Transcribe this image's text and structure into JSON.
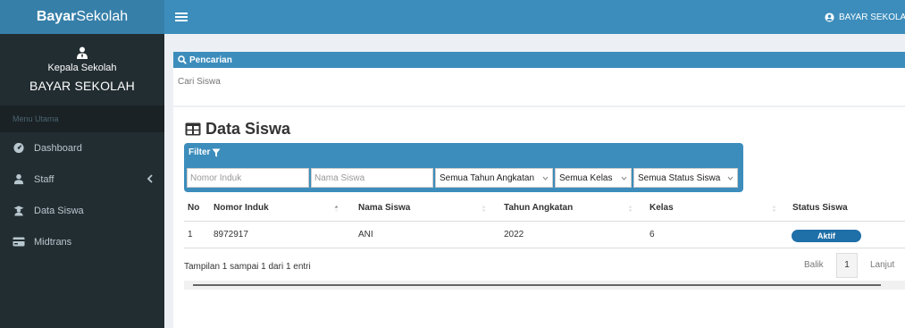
{
  "brand": {
    "bold": "Bayar",
    "rest": "Sekolah"
  },
  "user_panel": {
    "role": "Kepala Sekolah",
    "name": "BAYAR SEKOLAH"
  },
  "sidebar": {
    "header": "Menu Utama",
    "items": [
      {
        "label": "Dashboard",
        "icon": "dashboard-icon"
      },
      {
        "label": "Staff",
        "icon": "user-icon"
      },
      {
        "label": "Data Siswa",
        "icon": "student-icon"
      },
      {
        "label": "Midtrans",
        "icon": "credit-card-icon"
      }
    ]
  },
  "topbar": {
    "user": "BAYAR SEKOLAH"
  },
  "search": {
    "title": "Pencarian",
    "placeholder": "Cari Siswa"
  },
  "page": {
    "title": "Data Siswa"
  },
  "filter": {
    "label": "Filter",
    "nomor_placeholder": "Nomor Induk",
    "nama_placeholder": "Nama Siswa",
    "tahun_selected": "Semua Tahun Angkatan",
    "kelas_selected": "Semua Kelas",
    "status_selected": "Semua Status Siswa"
  },
  "table": {
    "headers": [
      "No",
      "Nomor Induk",
      "Nama Siswa",
      "Tahun Angkatan",
      "Kelas",
      "Status Siswa"
    ],
    "rows": [
      {
        "no": "1",
        "nomor_induk": "8972917",
        "nama": "ANI",
        "tahun": "2022",
        "kelas": "6",
        "status": "Aktif"
      }
    ]
  },
  "footer": {
    "info": "Tampilan 1 sampai 1 dari 1 entri",
    "prev": "Balik",
    "page": "1",
    "next": "Lanjut"
  },
  "colors": {
    "primary": "#3c8dbc",
    "brand": "#367fa9",
    "sidebar": "#222d32",
    "badge": "#1f6fa8"
  }
}
